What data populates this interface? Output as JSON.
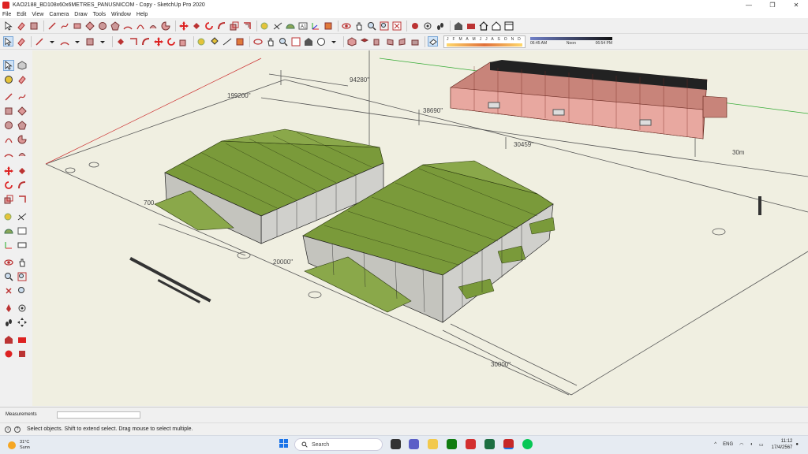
{
  "window": {
    "title": "KAO2188_BD108x60x6METRES_PANUSNICOM - Copy - SketchUp Pro 2020",
    "minimize": "—",
    "maximize": "❐",
    "close": "✕"
  },
  "menu": [
    "File",
    "Edit",
    "View",
    "Camera",
    "Draw",
    "Tools",
    "Window",
    "Help"
  ],
  "shadow": {
    "months": "J F M A M J J A S O N D",
    "time_start": "06:45 AM",
    "time_mid": "Noon",
    "time_end": "06:54 PM"
  },
  "dimensions": {
    "d1": "199200\"",
    "d2": "94280\"",
    "d3": "38690\"",
    "d4": "30459\"",
    "d5": "30m",
    "d6": "700",
    "d7": "20000\"",
    "d8": "30000\""
  },
  "measurements": {
    "label": "Measurements",
    "value": ""
  },
  "status": {
    "text": "Select objects. Shift to extend select. Drag mouse to select multiple.",
    "icon1": "i",
    "icon2": "?"
  },
  "taskbar": {
    "weather_temp": "31°C",
    "weather_desc": "Sunn",
    "search": "Search",
    "lang": "ENG",
    "time": "11:12",
    "date": "17/4/2567"
  },
  "colors": {
    "roof_green": "#7a9a3a",
    "roof_red": "#b04a3a",
    "canvas": "#f0efe1",
    "accent": "#1a73e8"
  }
}
